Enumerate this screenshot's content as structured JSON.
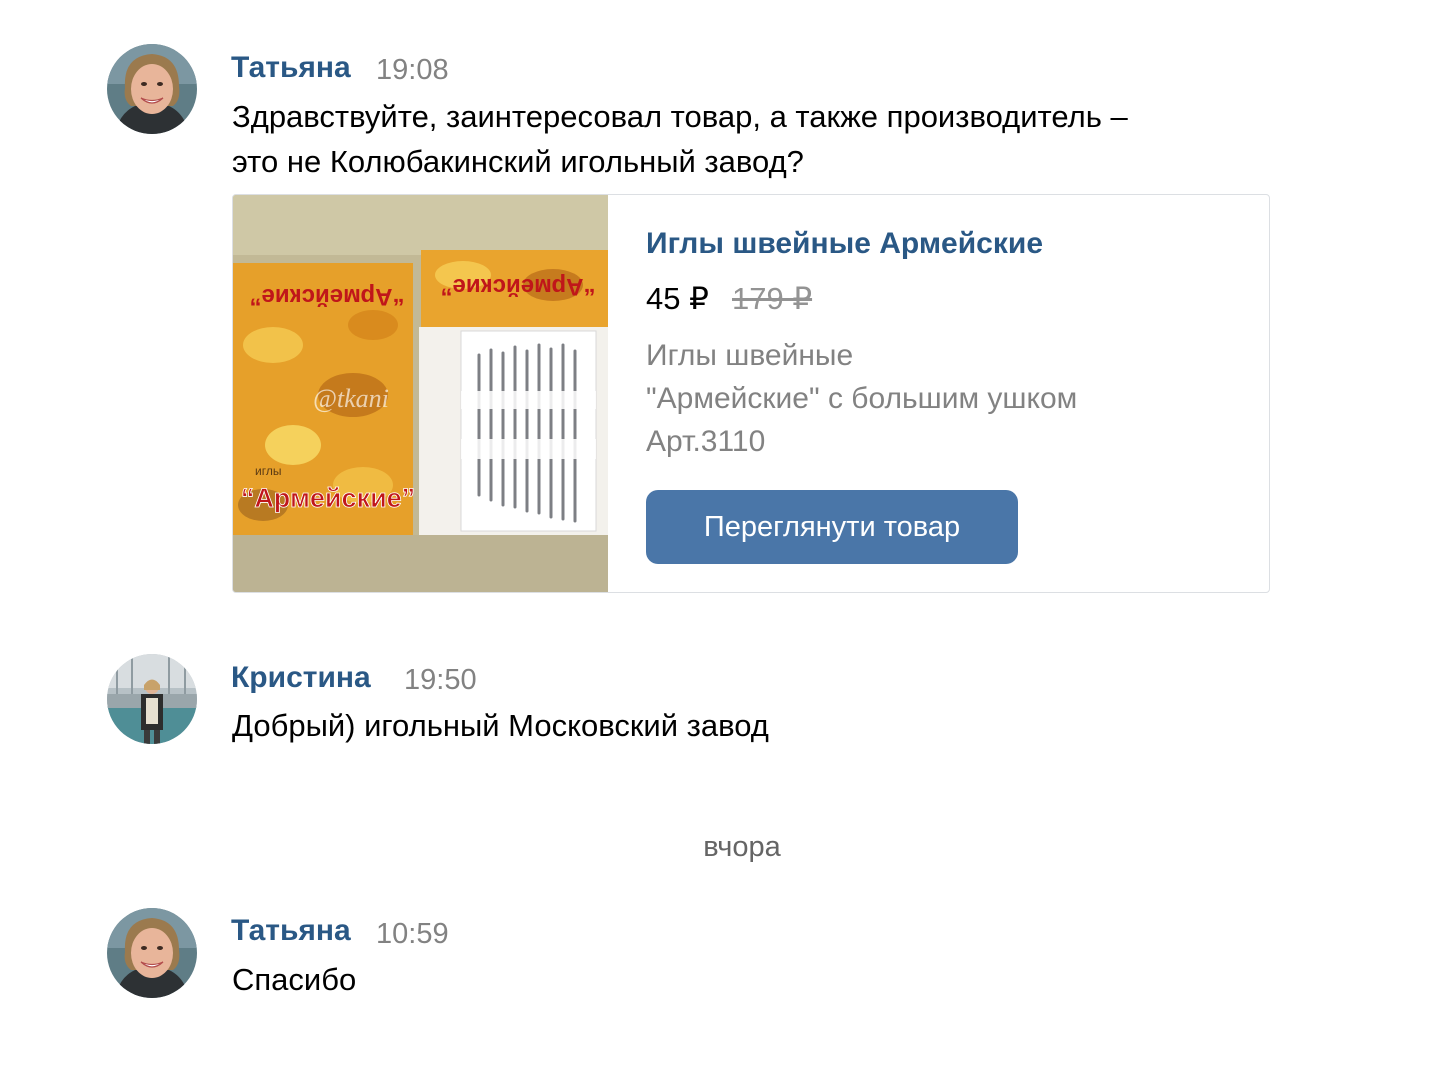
{
  "messages": [
    {
      "author": "Татьяна",
      "time": "19:08",
      "text_lines": [
        "Здравствуйте, заинтересовал товар, а также производитель –",
        "это не Колюбакинский игольный завод?"
      ],
      "avatar_icon": "user-avatar-photo",
      "attachment": {
        "product_title": "Иглы швейные Армейские",
        "price": "45 ₽",
        "old_price": "179 ₽",
        "description_lines": [
          "Иглы швейные",
          "\"Армейские\" с большим ушком",
          "Арт.3110"
        ],
        "button_label": "Переглянути товар",
        "image_texts": {
          "brand_main": "“Армейские”",
          "brand_small": "иглы",
          "watermark": "@tkani"
        }
      }
    },
    {
      "author": "Кристина",
      "time": "19:50",
      "text_lines": [
        "Добрый) игольный Московский завод"
      ],
      "avatar_icon": "user-avatar-photo"
    },
    {
      "author": "Татьяна",
      "time": "10:59",
      "text_lines": [
        "Спасибо"
      ],
      "avatar_icon": "user-avatar-photo"
    }
  ],
  "day_separator": "вчора",
  "colors": {
    "author_link": "#2a5885",
    "button_bg": "#4a76a8",
    "meta_gray": "#828282",
    "card_border": "#dcdfe3"
  }
}
